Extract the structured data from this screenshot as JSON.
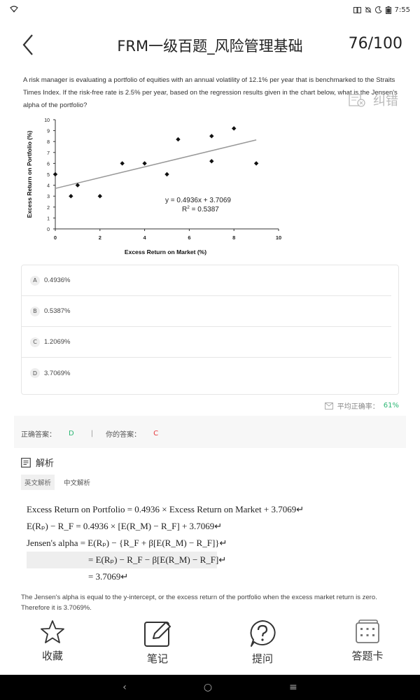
{
  "status_bar": {
    "time": "7:55"
  },
  "header": {
    "title": "FRM一级百题_风险管理基础",
    "progress": "76/100"
  },
  "question": {
    "text": "A risk manager is evaluating a portfolio of equities with an annual volatility of 12.1% per year that is benchmarked to the Straits Times Index. If the risk-free rate is 2.5% per year, based on the regression results given in the chart below, what is the Jensen's alpha of the portfolio?",
    "correction_label": "纠错"
  },
  "chart_data": {
    "type": "scatter",
    "xlabel": "Excess Return on Market (%)",
    "ylabel": "Excess Return on Portfolio (%)",
    "xlim": [
      0,
      10
    ],
    "ylim": [
      0,
      10
    ],
    "x_ticks": [
      "0",
      "2",
      "4",
      "6",
      "8",
      "10"
    ],
    "y_ticks": [
      "0",
      "1",
      "2",
      "3",
      "4",
      "5",
      "6",
      "7",
      "8",
      "9",
      "10"
    ],
    "points": [
      {
        "x": 0,
        "y": 5
      },
      {
        "x": 0.7,
        "y": 3
      },
      {
        "x": 1,
        "y": 4
      },
      {
        "x": 2,
        "y": 3
      },
      {
        "x": 3,
        "y": 6
      },
      {
        "x": 4,
        "y": 6
      },
      {
        "x": 5,
        "y": 5
      },
      {
        "x": 5.5,
        "y": 8.2
      },
      {
        "x": 7,
        "y": 8.5
      },
      {
        "x": 7,
        "y": 6.2
      },
      {
        "x": 8,
        "y": 9.2
      },
      {
        "x": 9,
        "y": 6
      }
    ],
    "trendline": {
      "slope": 0.4936,
      "intercept": 3.7069,
      "x_range": [
        0,
        9
      ]
    },
    "equation": "y = 0.4936x + 3.7069",
    "r2_label": "R",
    "r2_sup": "2",
    "r2_value": " = 0.5387",
    "grid": false
  },
  "options": [
    {
      "letter": "A",
      "text": "0.4936%"
    },
    {
      "letter": "B",
      "text": "0.5387%"
    },
    {
      "letter": "C",
      "text": "1.2069%"
    },
    {
      "letter": "D",
      "text": "3.7069%"
    }
  ],
  "accuracy": {
    "label": "平均正确率：",
    "value": "61%"
  },
  "answers": {
    "correct_label": "正确答案：",
    "correct": "D",
    "separator": "|",
    "yours_label": "你的答案：",
    "yours": "C"
  },
  "analysis": {
    "title": "解析",
    "tabs": [
      "英文解析",
      "中文解析"
    ],
    "formulas": [
      "Excess Return on Portfolio = 0.4936 × Excess Return on Market + 3.7069↵",
      "E(Rₚ) − R_F = 0.4936 × [E(R_M) − R_F] + 3.7069↵",
      "Jensen's alpha = E(Rₚ) − {R_F + β[E(R_M) − R_F]}↵",
      "= E(Rₚ) − R_F − β[E(R_M) − R_F]↵",
      "= 3.7069↵"
    ],
    "explanation": "The Jensen's alpha is equal to the y-intercept, or the excess return of the portfolio when the excess market return is zero. Therefore it is 3.7069%."
  },
  "toolbar": [
    {
      "label": "收藏",
      "icon": "star-icon"
    },
    {
      "label": "笔记",
      "icon": "edit-note-icon"
    },
    {
      "label": "提问",
      "icon": "question-icon"
    },
    {
      "label": "答题卡",
      "icon": "answer-card-icon"
    }
  ],
  "nav_bar": {
    "back": "‹",
    "home": "○",
    "menu": "≡"
  }
}
